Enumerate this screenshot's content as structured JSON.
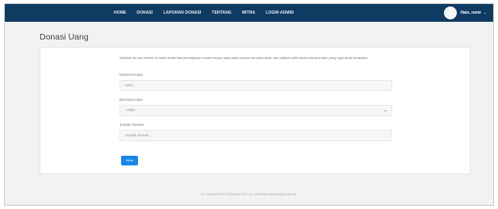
{
  "navbar": {
    "links": [
      "HOME",
      "DONASI",
      "LAPORAN DONASI",
      "TENTANG",
      "MITRA",
      "LOGIN ADMIN"
    ],
    "user_label": "Halo, nemi",
    "caret": "⌄",
    "bg_color": "#0f3a62"
  },
  "page": {
    "title": "Donasi Uang"
  },
  "form": {
    "intro": "Silahkan isi form berikut ini untuk konfirmasi pembayaran donasi berupa uang untuk korban bencana alam, dan silahkan pilih lokasi bencana alam yang ingin anda donasikan.",
    "donor_label": "Nama Donatur",
    "donor_value": "nemi",
    "disaster_label": "Bencana Alam",
    "disaster_selected": "--Pilih--",
    "amount_label": "Jumlah Donasi",
    "amount_placeholder": "Jumlah donasi...",
    "submit_label": "Kirim",
    "accent_color": "#1a86e8"
  },
  "footer": {
    "text": "E-COMMERCE DONASI UNTUK KORBAN BENCANA ALAM"
  }
}
